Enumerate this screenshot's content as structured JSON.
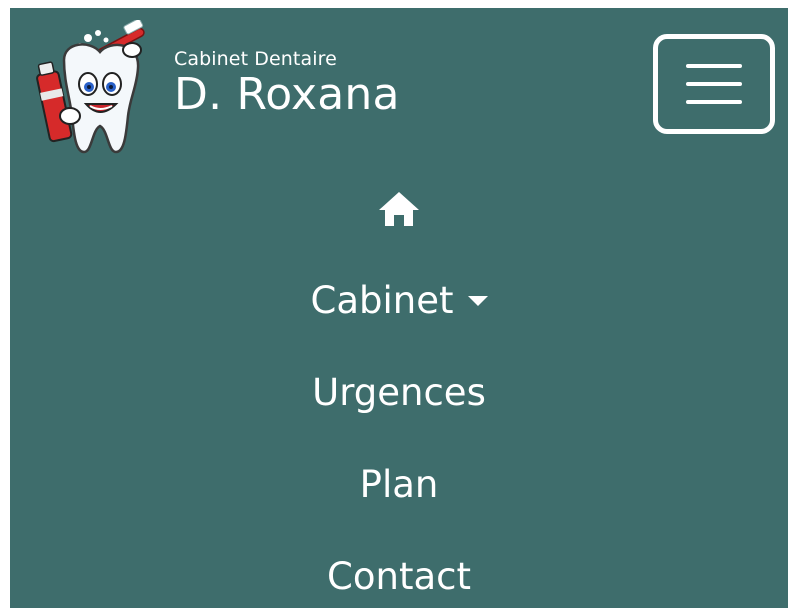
{
  "brand": {
    "subtitle": "Cabinet Dentaire",
    "name": "D. Roxana",
    "logo_icon": "tooth-mascot-icon"
  },
  "toggle": {
    "icon": "hamburger-menu-icon"
  },
  "nav": {
    "home_icon": "home-icon",
    "items": [
      {
        "label": "Cabinet",
        "has_dropdown": true
      },
      {
        "label": "Urgences"
      },
      {
        "label": "Plan"
      },
      {
        "label": "Contact"
      }
    ]
  },
  "colors": {
    "background": "#3e6d6c",
    "text": "#ffffff"
  }
}
